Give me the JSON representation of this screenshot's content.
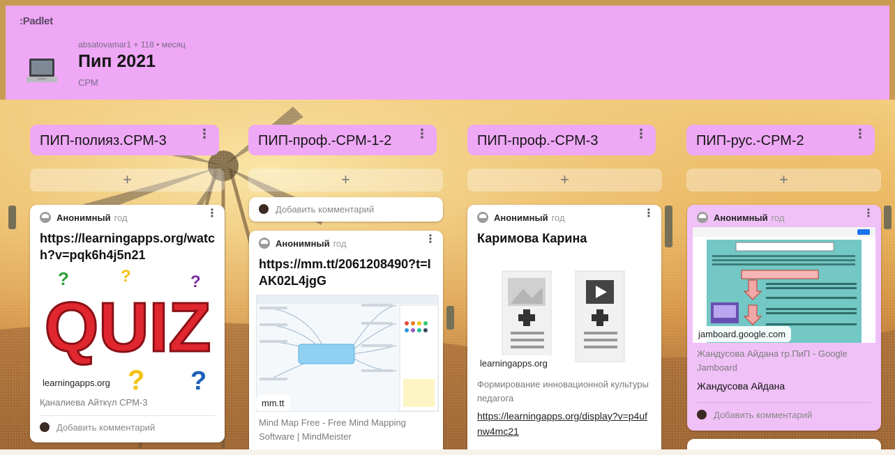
{
  "header": {
    "logo": ":Padlet",
    "meta": "absatovamar1 + 118 • месяц",
    "title": "Пип 2021",
    "subtitle": "СРМ",
    "board_icon": "laptop-icon"
  },
  "columns": [
    {
      "label": "ПИП-полияз.СРМ-3",
      "add": "+"
    },
    {
      "label": "ПИП-проф.-СРМ-1-2",
      "add": "+"
    },
    {
      "label": "ПИП-проф.-СРМ-3",
      "add": "+"
    },
    {
      "label": "ПИП-рус.-СРМ-2",
      "add": "+"
    }
  ],
  "posts": {
    "c1": {
      "author": "Анонимный",
      "time": "год",
      "title": "https://learningapps.org/watch?v=pqk6h4j5n21",
      "domain": "learningapps.org",
      "caption": "Қаналиева Айткүл СРМ-3",
      "comment": "Добавить комментарий",
      "image_text": "QUIZ"
    },
    "c2_top": {
      "comment": "Добавить комментарий"
    },
    "c2": {
      "author": "Анонимный",
      "time": "год",
      "title": "https://mm.tt/2061208490?t=IAK02L4jgG",
      "domain": "mm.tt",
      "caption": "Mind Map Free - Free Mind Mapping Software | MindMeister"
    },
    "c3": {
      "author": "Анонимный",
      "time": "год",
      "title": "Каримова Карина",
      "domain": "learningapps.org",
      "caption": "Формирование инновационной культуры педагога",
      "link": "https://learningapps.org/display?v=p4ufnw4mc21"
    },
    "c4": {
      "author": "Анонимный",
      "time": "год",
      "domain": "jamboard.google.com",
      "caption": "Жандусова Айдана гр.ПиП - Google Jamboard",
      "body": "Жандусова Айдана",
      "comment": "Добавить комментарий"
    }
  },
  "colors": {
    "accent": "#eea8f5",
    "card_pink": "#f0c1f7"
  }
}
